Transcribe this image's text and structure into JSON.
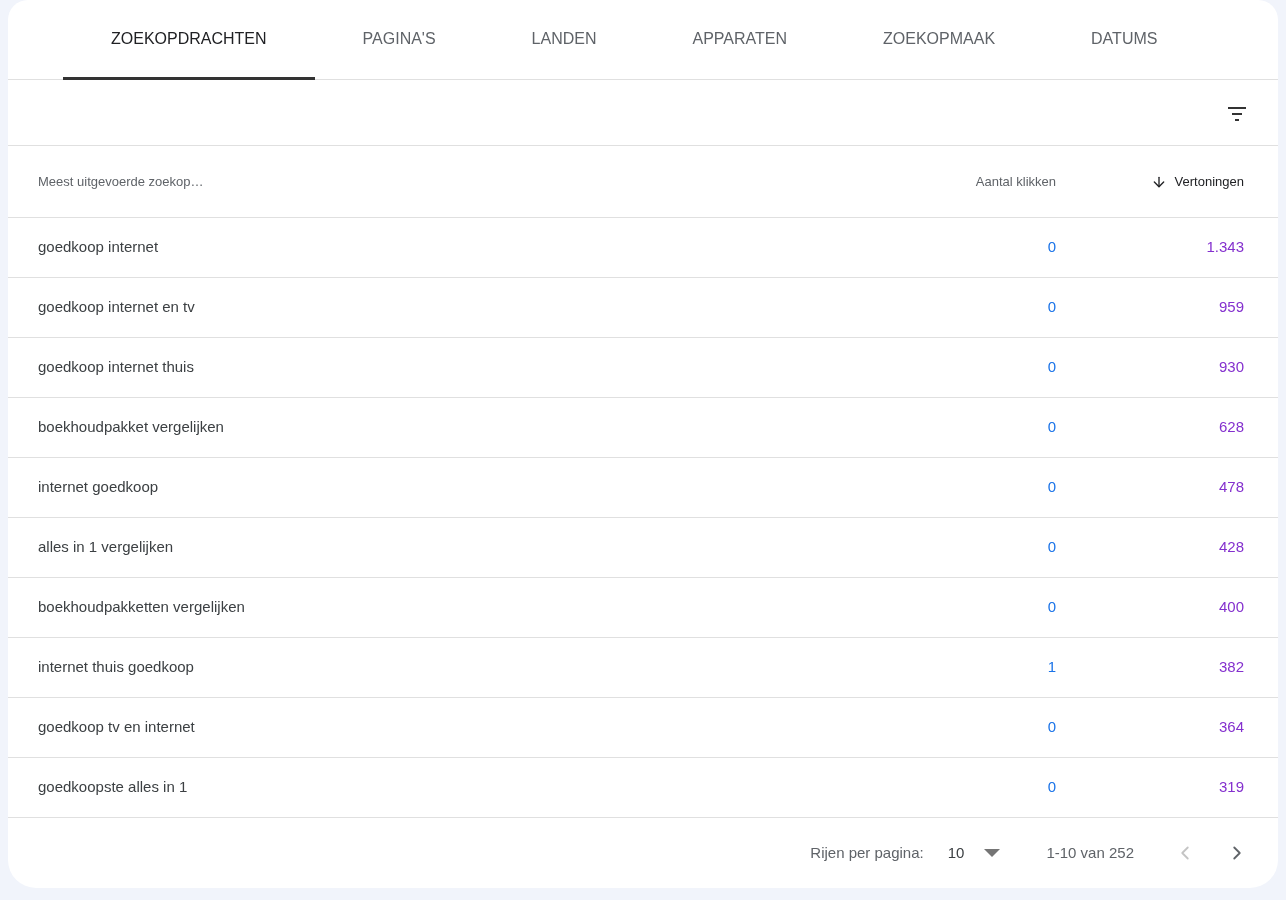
{
  "tabs": [
    {
      "label": "ZOEKOPDRACHTEN",
      "selected": true
    },
    {
      "label": "PAGINA'S",
      "selected": false
    },
    {
      "label": "LANDEN",
      "selected": false
    },
    {
      "label": "APPARATEN",
      "selected": false
    },
    {
      "label": "ZOEKOPMAAK",
      "selected": false
    },
    {
      "label": "DATUMS",
      "selected": false
    }
  ],
  "table": {
    "columns": [
      {
        "label": "Meest uitgevoerde zoekop…",
        "sorted": false
      },
      {
        "label": "Aantal klikken",
        "sorted": false,
        "color": "#1a73e8"
      },
      {
        "label": "Vertoningen",
        "sorted": true,
        "color": "#8430ce"
      }
    ],
    "rows": [
      [
        "goedkoop internet",
        "0",
        "1.343"
      ],
      [
        "goedkoop internet en tv",
        "0",
        "959"
      ],
      [
        "goedkoop internet thuis",
        "0",
        "930"
      ],
      [
        "boekhoudpakket vergelijken",
        "0",
        "628"
      ],
      [
        "internet goedkoop",
        "0",
        "478"
      ],
      [
        "alles in 1 vergelijken",
        "0",
        "428"
      ],
      [
        "boekhoudpakketten vergelijken",
        "0",
        "400"
      ],
      [
        "internet thuis goedkoop",
        "1",
        "382"
      ],
      [
        "goedkoop tv en internet",
        "0",
        "364"
      ],
      [
        "goedkoopste alles in 1",
        "0",
        "319"
      ]
    ]
  },
  "pagination": {
    "rows_label": "Rijen per pagina:",
    "rows_value": "10",
    "range": "1-10 van 252",
    "prev_disabled": true,
    "next_disabled": false
  }
}
